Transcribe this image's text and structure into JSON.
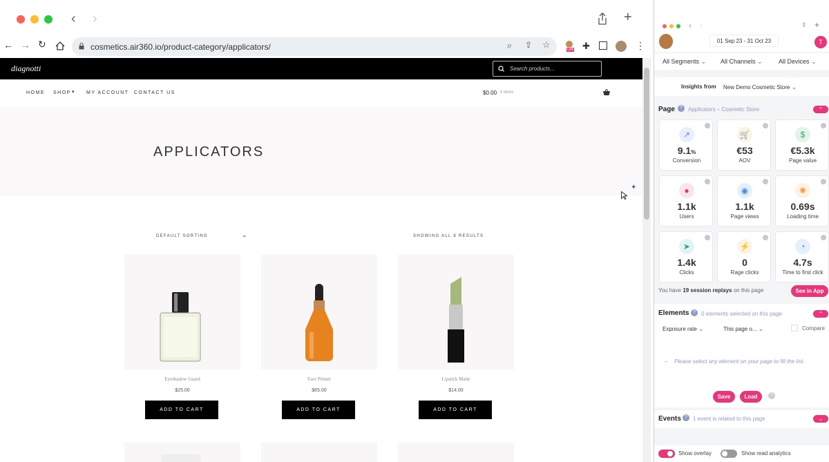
{
  "browser": {
    "url": "cosmetics.air360.io/product-category/applicators/",
    "extension_badge": "ON"
  },
  "site": {
    "logo": "diagnotti",
    "search_placeholder": "Search products...",
    "nav": [
      "HOME",
      "SHOP",
      "MY ACCOUNT",
      "CONTACT US"
    ],
    "cart_total": "$0.00",
    "cart_items": "0 items",
    "page_title": "APPLICATORS",
    "sorting": "DEFAULT SORTING",
    "results": "SHOWING ALL 8 RESULTS",
    "add_to_cart": "ADD TO CART",
    "products": [
      {
        "name": "Eyeshadow Guard",
        "price": "$25.00"
      },
      {
        "name": "Face Primer",
        "price": "$65.00"
      },
      {
        "name": "Lipstick Matte",
        "price": "$14.00"
      }
    ]
  },
  "panel": {
    "date_range": "01 Sep 23 - 31 Oct 23",
    "avatar_letter": "T",
    "filters": [
      "All Segments",
      "All Channels",
      "All Devices"
    ],
    "insights_label": "Insights from",
    "insights_value": "New Demo Cosmetic Store",
    "page_label": "Page",
    "page_name": "Applicators – Cosmetic Store",
    "metrics": [
      {
        "value": "9.1",
        "unit": "%",
        "label": "Conversion",
        "icon": "trend-up-icon",
        "color": "#5b8def"
      },
      {
        "value": "€53",
        "unit": "",
        "label": "AOV",
        "icon": "cart-icon",
        "color": "#f39c33"
      },
      {
        "value": "€5.3k",
        "unit": "",
        "label": "Page value",
        "icon": "dollar-icon",
        "color": "#2eae62"
      },
      {
        "value": "1.1k",
        "unit": "",
        "label": "Users",
        "icon": "users-icon",
        "color": "#e8367a"
      },
      {
        "value": "1.1k",
        "unit": "",
        "label": "Page views",
        "icon": "eye-icon",
        "color": "#3b8fe0"
      },
      {
        "value": "0.69s",
        "unit": "",
        "label": "Loading time",
        "icon": "loading-icon",
        "color": "#f39c33"
      },
      {
        "value": "1.4k",
        "unit": "",
        "label": "Clicks",
        "icon": "cursor-icon",
        "color": "#1fa5a0"
      },
      {
        "value": "0",
        "unit": "",
        "label": "Rage clicks",
        "icon": "bolt-icon",
        "color": "#f39c33"
      },
      {
        "value": "4.7s",
        "unit": "",
        "label": "Time to first click",
        "icon": "clock-icon",
        "color": "#3b8fe0"
      }
    ],
    "session_prefix": "You have",
    "session_count": "19 session replays",
    "session_suffix": "on this page",
    "see_in_app": "See in App",
    "elements_label": "Elements",
    "elements_note": "0 elements selected on this page",
    "exposure": "Exposure rate",
    "this_page": "This page o...",
    "compare": "Compare",
    "select_hint": "Please select any element on your page to fill the list.",
    "save": "Save",
    "load": "Load",
    "events_label": "Events",
    "events_note": "1 event is related to this page",
    "show_overlay": "Show overlay",
    "show_read": "Show read analytics"
  }
}
